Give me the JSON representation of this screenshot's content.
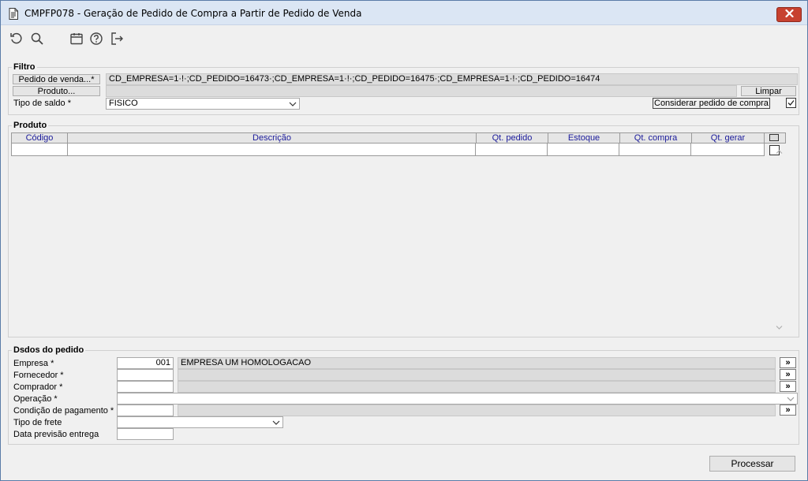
{
  "window": {
    "title": "CMPFP078 - Geração de Pedido de Compra a Partir de Pedido de Venda"
  },
  "filtro": {
    "legend": "Filtro",
    "pedido_venda_label": "Pedido de venda...*",
    "pedido_venda_value": "CD_EMPRESA=1·!·;CD_PEDIDO=16473·;CD_EMPRESA=1·!·;CD_PEDIDO=16475·;CD_EMPRESA=1·!·;CD_PEDIDO=16474",
    "produto_label": "Produto...",
    "produto_value": "",
    "limpar_label": "Limpar",
    "tipo_saldo_label": "Tipo de saldo *",
    "tipo_saldo_value": "FISICO",
    "considerar_label": "Considerar pedido de compra",
    "considerar_checked": true
  },
  "produto": {
    "legend": "Produto",
    "columns": [
      "Código",
      "Descrição",
      "Qt. pedido",
      "Estoque",
      "Qt. compra",
      "Qt. gerar"
    ]
  },
  "dados": {
    "legend": "Dsdos do pedido",
    "empresa_label": "Empresa *",
    "empresa_code": "001",
    "empresa_name": "EMPRESA UM HOMOLOGACAO",
    "fornecedor_label": "Fornecedor *",
    "comprador_label": "Comprador *",
    "operacao_label": "Operação *",
    "condicao_label": "Condição de pagamento *",
    "tipo_frete_label": "Tipo de frete",
    "data_previsao_label": "Data previsão entrega",
    "lookup_label": "»"
  },
  "footer": {
    "processar_label": "Processar"
  },
  "icons": [
    "document-icon",
    "close-icon",
    "refresh-icon",
    "search-icon",
    "calendar-icon",
    "help-icon",
    "exit-icon"
  ]
}
